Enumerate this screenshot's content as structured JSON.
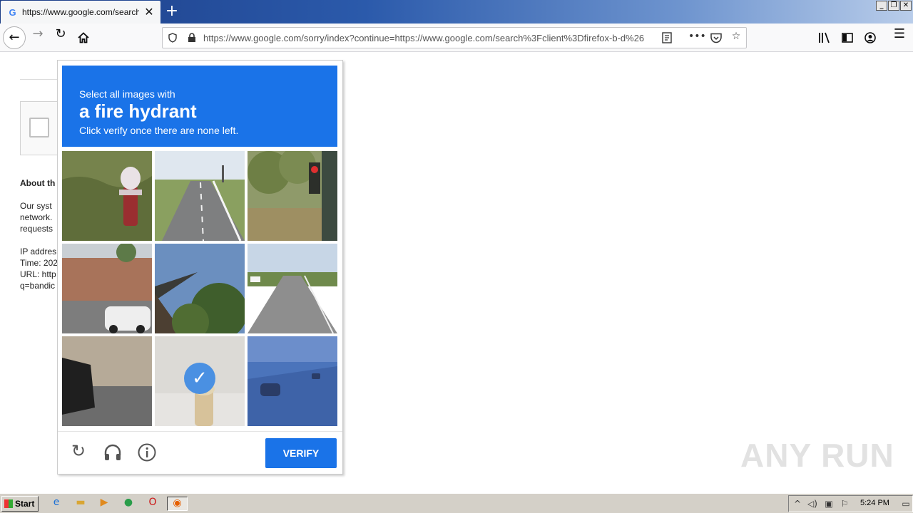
{
  "browser": {
    "tab": {
      "favicon": "G",
      "title": "https://www.google.com/search?c",
      "close": "✕"
    },
    "new_tab": "+",
    "window_buttons": [
      "_",
      "❐",
      "✕"
    ],
    "url": "https://www.google.com/sorry/index?continue=https://www.google.com/search%3Fclient%3Dfirefox-b-d%26"
  },
  "page": {
    "about_heading": "About th",
    "para_lines": [
      "Our syst",
      "network.",
      "requests"
    ],
    "info_lines": [
      "IP addres",
      "Time: 202",
      "URL: http",
      "q=bandic"
    ]
  },
  "captcha": {
    "instruction": "Select all images with",
    "target": "a fire hydrant",
    "hint": "Click verify once there are none left.",
    "check_mark": "✓",
    "verify_label": "VERIFY",
    "tiles_selected": [
      false,
      false,
      false,
      false,
      false,
      false,
      false,
      true,
      false
    ]
  },
  "watermark": "ANY RUN",
  "taskbar": {
    "start_label": "Start",
    "clock": "5:24 PM"
  }
}
